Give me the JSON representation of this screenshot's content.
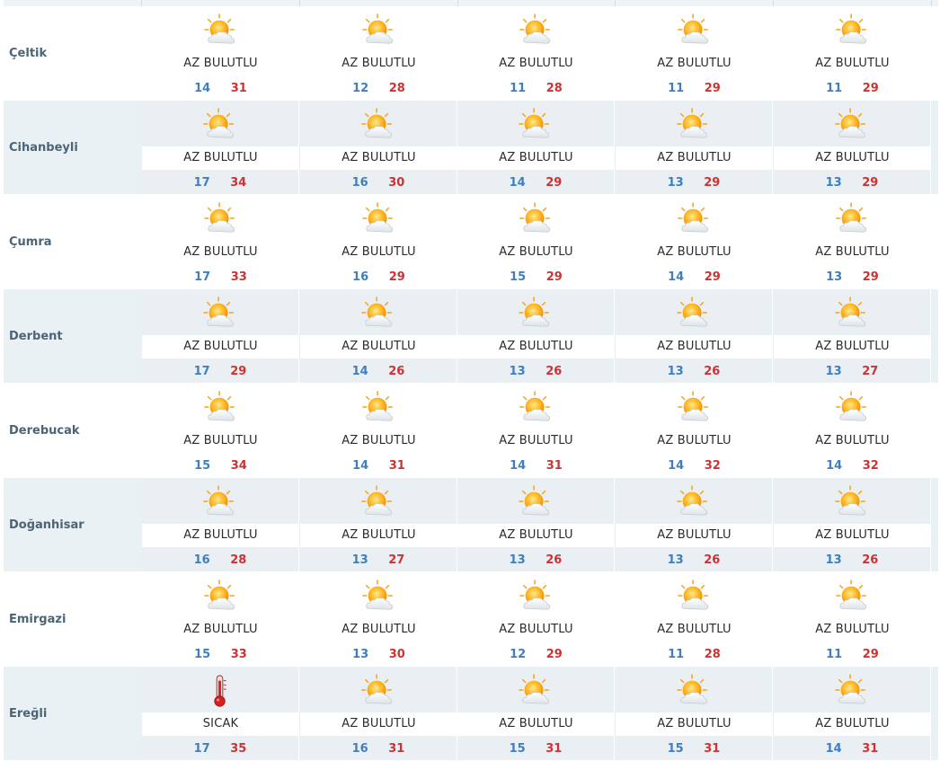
{
  "colors": {
    "district_text": "#4b6476",
    "min_temp": "#3f7fbf",
    "max_temp": "#cc3333",
    "row_shade": "#e9f1f5"
  },
  "rows": [
    {
      "district": "Çeltik",
      "days": [
        {
          "icon": "partly-cloudy-sun-icon",
          "desc": "AZ BULUTLU",
          "min": "14",
          "max": "31"
        },
        {
          "icon": "partly-cloudy-sun-icon",
          "desc": "AZ BULUTLU",
          "min": "12",
          "max": "28"
        },
        {
          "icon": "partly-cloudy-sun-icon",
          "desc": "AZ BULUTLU",
          "min": "11",
          "max": "28"
        },
        {
          "icon": "partly-cloudy-sun-icon",
          "desc": "AZ BULUTLU",
          "min": "11",
          "max": "29"
        },
        {
          "icon": "partly-cloudy-sun-icon",
          "desc": "AZ BULUTLU",
          "min": "11",
          "max": "29"
        }
      ]
    },
    {
      "district": "Cihanbeyli",
      "days": [
        {
          "icon": "partly-cloudy-sun-icon",
          "desc": "AZ BULUTLU",
          "min": "17",
          "max": "34"
        },
        {
          "icon": "partly-cloudy-sun-icon",
          "desc": "AZ BULUTLU",
          "min": "16",
          "max": "30"
        },
        {
          "icon": "partly-cloudy-sun-icon",
          "desc": "AZ BULUTLU",
          "min": "14",
          "max": "29"
        },
        {
          "icon": "partly-cloudy-sun-icon",
          "desc": "AZ BULUTLU",
          "min": "13",
          "max": "29"
        },
        {
          "icon": "partly-cloudy-sun-icon",
          "desc": "AZ BULUTLU",
          "min": "13",
          "max": "29"
        }
      ]
    },
    {
      "district": "Çumra",
      "days": [
        {
          "icon": "partly-cloudy-sun-icon",
          "desc": "AZ BULUTLU",
          "min": "17",
          "max": "33"
        },
        {
          "icon": "partly-cloudy-sun-icon",
          "desc": "AZ BULUTLU",
          "min": "16",
          "max": "29"
        },
        {
          "icon": "partly-cloudy-sun-icon",
          "desc": "AZ BULUTLU",
          "min": "15",
          "max": "29"
        },
        {
          "icon": "partly-cloudy-sun-icon",
          "desc": "AZ BULUTLU",
          "min": "14",
          "max": "29"
        },
        {
          "icon": "partly-cloudy-sun-icon",
          "desc": "AZ BULUTLU",
          "min": "13",
          "max": "29"
        }
      ]
    },
    {
      "district": "Derbent",
      "days": [
        {
          "icon": "partly-cloudy-sun-icon",
          "desc": "AZ BULUTLU",
          "min": "17",
          "max": "29"
        },
        {
          "icon": "partly-cloudy-sun-icon",
          "desc": "AZ BULUTLU",
          "min": "14",
          "max": "26"
        },
        {
          "icon": "partly-cloudy-sun-icon",
          "desc": "AZ BULUTLU",
          "min": "13",
          "max": "26"
        },
        {
          "icon": "partly-cloudy-sun-icon",
          "desc": "AZ BULUTLU",
          "min": "13",
          "max": "26"
        },
        {
          "icon": "partly-cloudy-sun-icon",
          "desc": "AZ BULUTLU",
          "min": "13",
          "max": "27"
        }
      ]
    },
    {
      "district": "Derebucak",
      "days": [
        {
          "icon": "partly-cloudy-sun-icon",
          "desc": "AZ BULUTLU",
          "min": "15",
          "max": "34"
        },
        {
          "icon": "partly-cloudy-sun-icon",
          "desc": "AZ BULUTLU",
          "min": "14",
          "max": "31"
        },
        {
          "icon": "partly-cloudy-sun-icon",
          "desc": "AZ BULUTLU",
          "min": "14",
          "max": "31"
        },
        {
          "icon": "partly-cloudy-sun-icon",
          "desc": "AZ BULUTLU",
          "min": "14",
          "max": "32"
        },
        {
          "icon": "partly-cloudy-sun-icon",
          "desc": "AZ BULUTLU",
          "min": "14",
          "max": "32"
        }
      ]
    },
    {
      "district": "Doğanhisar",
      "days": [
        {
          "icon": "partly-cloudy-sun-icon",
          "desc": "AZ BULUTLU",
          "min": "16",
          "max": "28"
        },
        {
          "icon": "partly-cloudy-sun-icon",
          "desc": "AZ BULUTLU",
          "min": "13",
          "max": "27"
        },
        {
          "icon": "partly-cloudy-sun-icon",
          "desc": "AZ BULUTLU",
          "min": "13",
          "max": "26"
        },
        {
          "icon": "partly-cloudy-sun-icon",
          "desc": "AZ BULUTLU",
          "min": "13",
          "max": "26"
        },
        {
          "icon": "partly-cloudy-sun-icon",
          "desc": "AZ BULUTLU",
          "min": "13",
          "max": "26"
        }
      ]
    },
    {
      "district": "Emirgazi",
      "days": [
        {
          "icon": "partly-cloudy-sun-icon",
          "desc": "AZ BULUTLU",
          "min": "15",
          "max": "33"
        },
        {
          "icon": "partly-cloudy-sun-icon",
          "desc": "AZ BULUTLU",
          "min": "13",
          "max": "30"
        },
        {
          "icon": "partly-cloudy-sun-icon",
          "desc": "AZ BULUTLU",
          "min": "12",
          "max": "29"
        },
        {
          "icon": "partly-cloudy-sun-icon",
          "desc": "AZ BULUTLU",
          "min": "11",
          "max": "28"
        },
        {
          "icon": "partly-cloudy-sun-icon",
          "desc": "AZ BULUTLU",
          "min": "11",
          "max": "29"
        }
      ]
    },
    {
      "district": "Ereğli",
      "days": [
        {
          "icon": "thermometer-hot-icon",
          "desc": "SICAK",
          "min": "17",
          "max": "35"
        },
        {
          "icon": "partly-cloudy-sun-icon",
          "desc": "AZ BULUTLU",
          "min": "16",
          "max": "31"
        },
        {
          "icon": "partly-cloudy-sun-icon",
          "desc": "AZ BULUTLU",
          "min": "15",
          "max": "31"
        },
        {
          "icon": "partly-cloudy-sun-icon",
          "desc": "AZ BULUTLU",
          "min": "15",
          "max": "31"
        },
        {
          "icon": "partly-cloudy-sun-icon",
          "desc": "AZ BULUTLU",
          "min": "14",
          "max": "31"
        }
      ]
    }
  ]
}
